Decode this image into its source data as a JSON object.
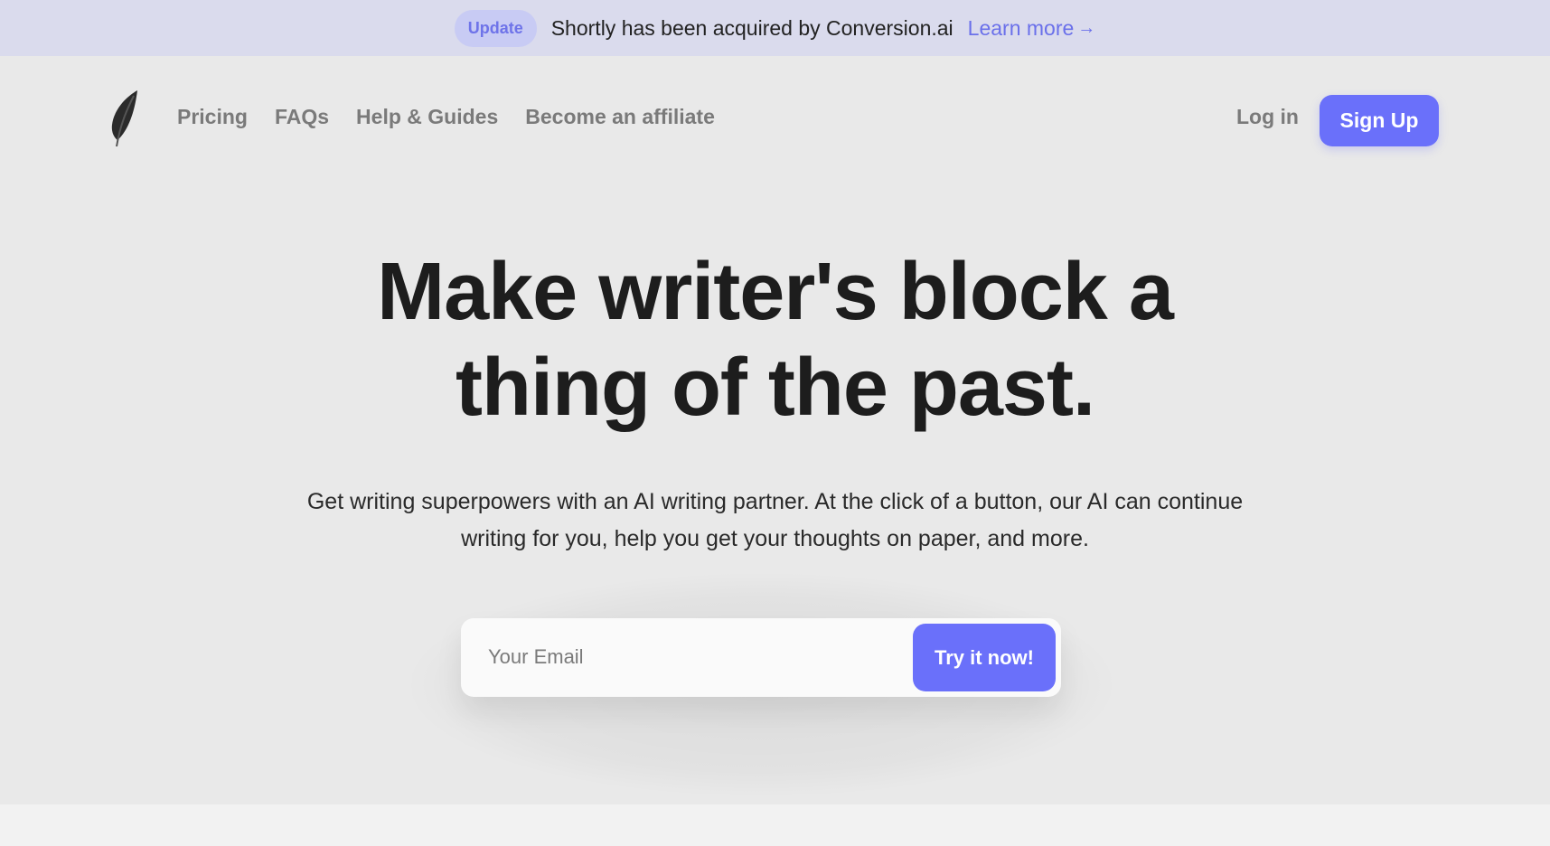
{
  "banner": {
    "badge": "Update",
    "text": "Shortly has been acquired by Conversion.ai",
    "link": "Learn more",
    "link_arrow": "→"
  },
  "nav": {
    "logo_icon": "feather-icon",
    "links": [
      "Pricing",
      "FAQs",
      "Help & Guides",
      "Become an affiliate"
    ],
    "login": "Log in",
    "signup": "Sign Up"
  },
  "hero": {
    "title_line1": "Make writer's block a",
    "title_line2": "thing of the past.",
    "subtitle_line1": "Get writing superpowers with an AI writing partner. At the click of a button, our AI can continue",
    "subtitle_line2": "writing for you, help you get your thoughts on paper, and more."
  },
  "cta": {
    "email_placeholder": "Your Email",
    "email_value": "",
    "button": "Try it now!"
  },
  "colors": {
    "accent": "#6a70fa",
    "banner_bg": "#dadbed",
    "page_bg": "#e9e9e9"
  }
}
